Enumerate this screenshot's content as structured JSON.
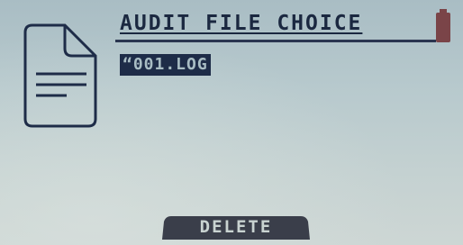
{
  "screen": {
    "title": "AUDIT FILE CHOICE",
    "battery_icon": "battery-icon",
    "document_icon": "document-icon"
  },
  "files": [
    {
      "name": "“001.LOG"
    }
  ],
  "softkeys": {
    "delete_label": "DELETE"
  },
  "colors": {
    "lcd_background": "#b7c9cd",
    "lcd_ink": "#1e2c48",
    "battery": "#7a4448"
  }
}
